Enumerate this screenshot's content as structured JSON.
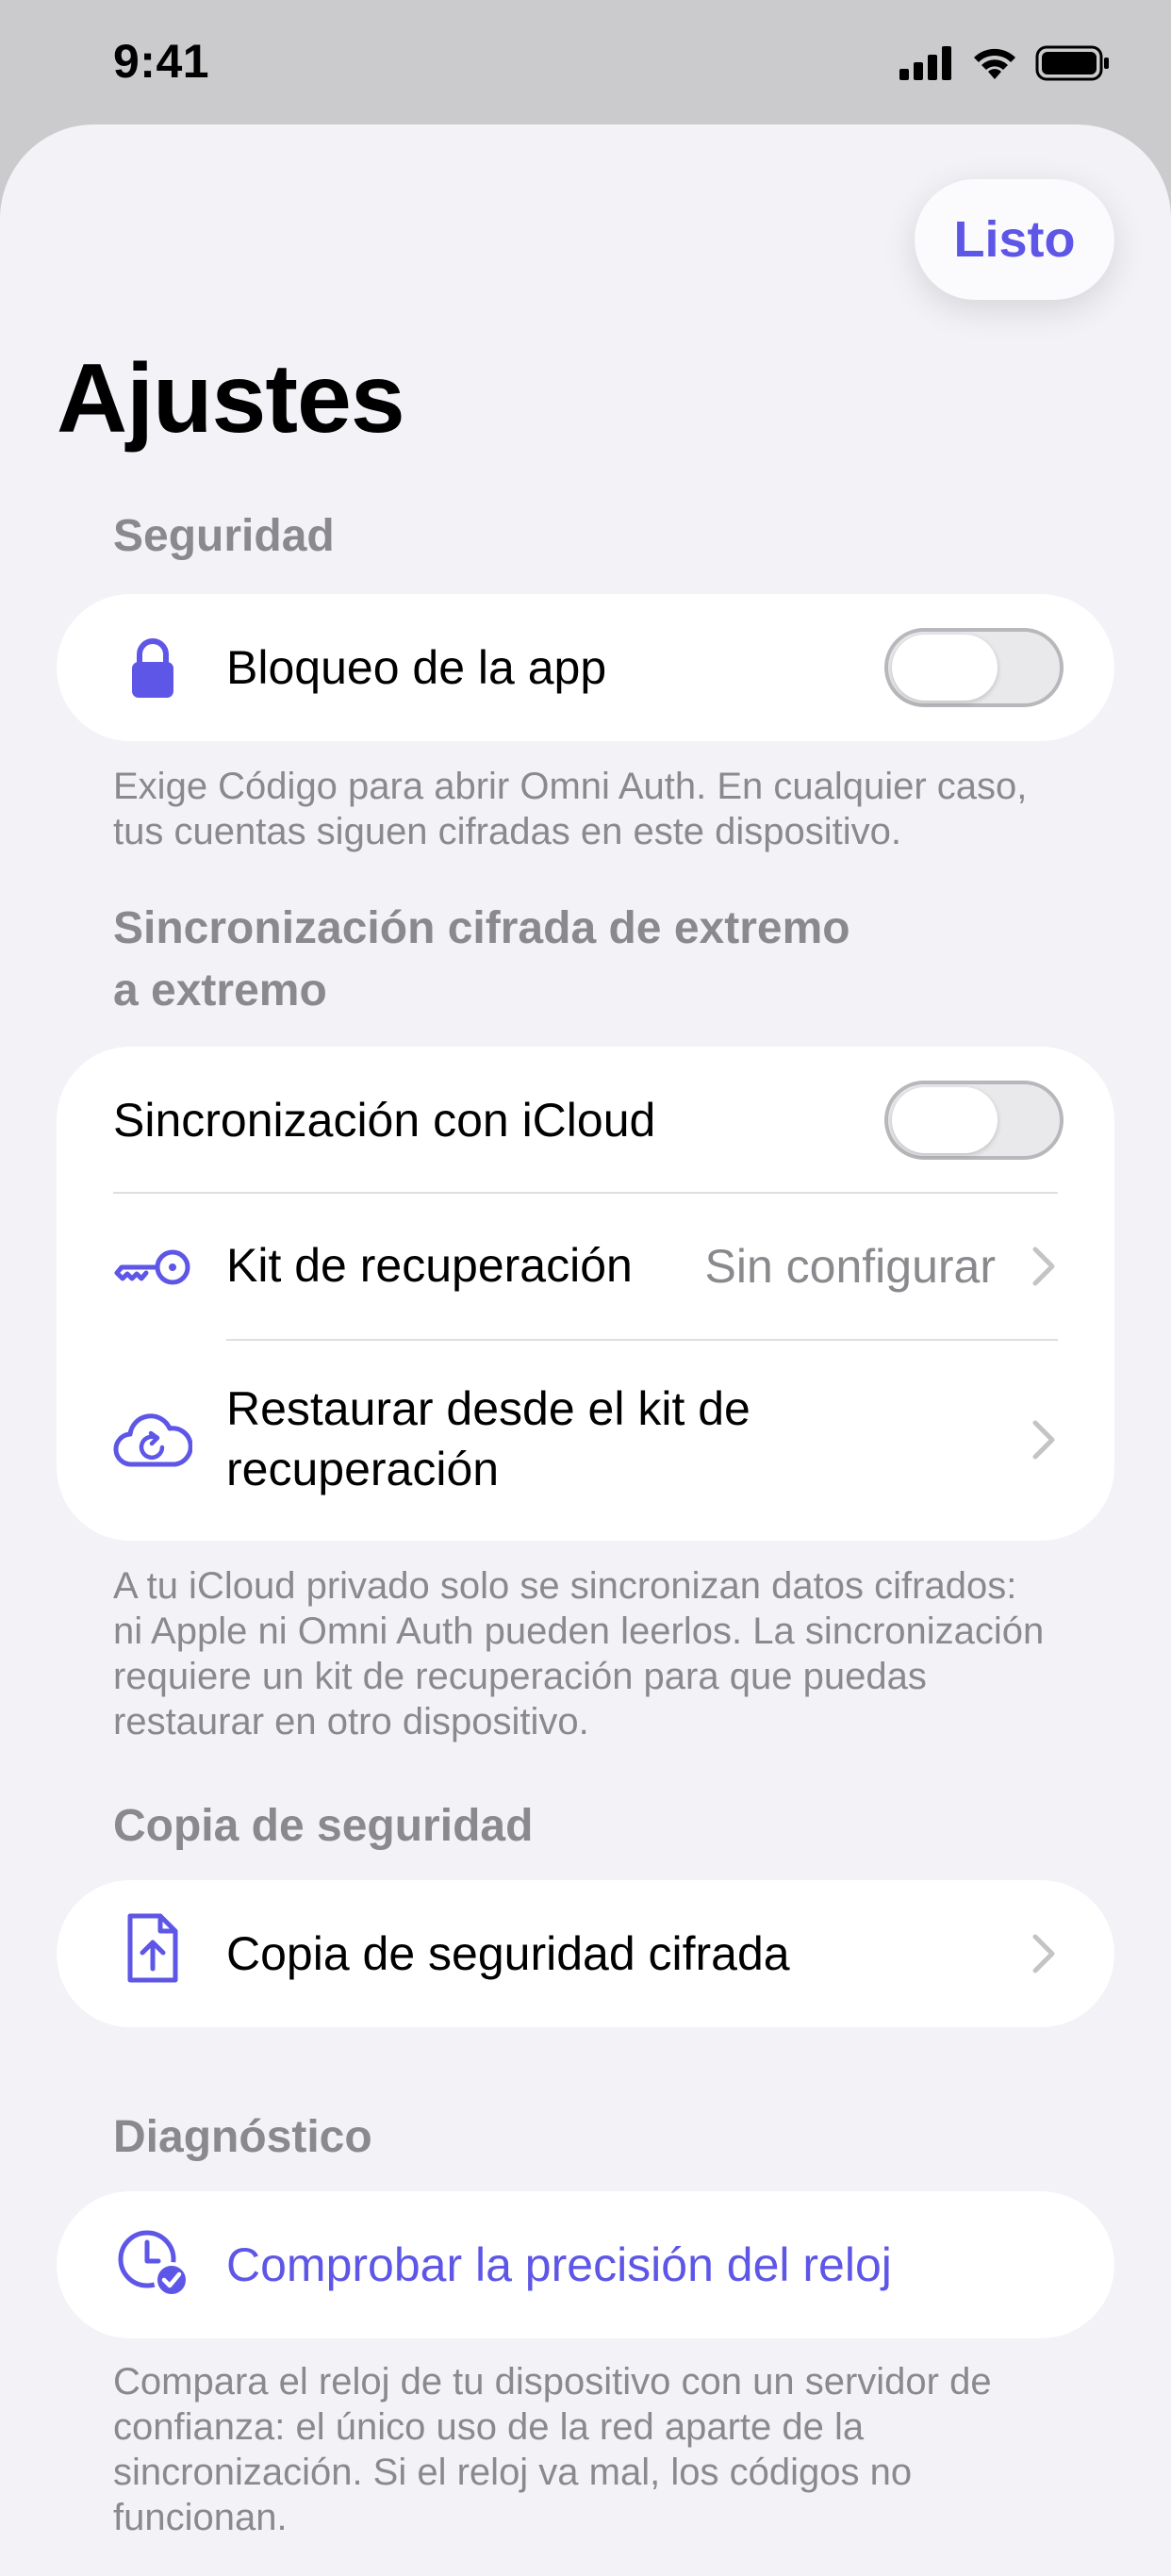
{
  "status_bar": {
    "time": "9:41"
  },
  "nav": {
    "done_label": "Listo",
    "title": "Ajustes"
  },
  "security": {
    "header": "Seguridad",
    "app_lock_label": "Bloqueo de la app",
    "app_lock_on": false,
    "footer": "Exige Código para abrir Omni Auth. En cualquier caso, tus cuentas siguen cifradas en este dispositivo."
  },
  "sync": {
    "header_line1": "Sincronización cifrada de extremo",
    "header_line2": "a extremo",
    "icloud_label": "Sincronización con iCloud",
    "icloud_on": false,
    "recovery_kit_label": "Kit de recuperación",
    "recovery_kit_value": "Sin configurar",
    "restore_line1": "Restaurar desde el kit de",
    "restore_line2": "recuperación",
    "footer": "A tu iCloud privado solo se sincronizan datos cifrados: ni Apple ni Omni Auth pueden leerlos. La sincronización requiere un kit de recuperación para que puedas restaurar en otro dispositivo."
  },
  "backup": {
    "header": "Copia de seguridad",
    "encrypted_backup_label": "Copia de seguridad cifrada"
  },
  "diagnostics": {
    "header": "Diagnóstico",
    "clock_check_label": "Comprobar la precisión del reloj",
    "footer": "Compara el reloj de tu dispositivo con un servidor de confianza: el único uso de la red aparte de la sincronización. Si el reloj va mal, los códigos no funcionan."
  },
  "icons": {
    "lock": "lock-icon",
    "key": "key-icon",
    "cloud_restore": "cloud-restore-icon",
    "doc_upload": "document-upload-icon",
    "clock_check": "clock-check-icon",
    "chevron": "chevron-right-icon"
  },
  "colors": {
    "accent": "#5e56e7",
    "background": "#f2f2f7",
    "secondary_text": "#8a8a8e"
  }
}
